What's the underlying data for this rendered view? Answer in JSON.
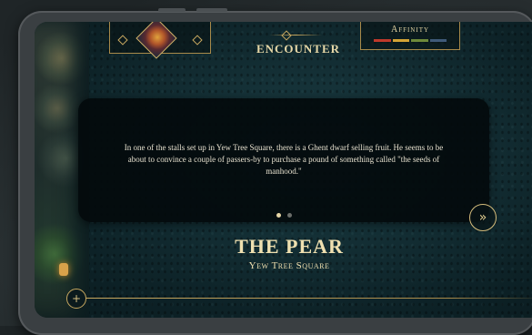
{
  "header": {
    "title": "Encounter",
    "affinity_label": "Affinity",
    "affinity_colors": [
      "#c0392b",
      "#d4a435",
      "#6f8a3a",
      "#3f5a7a"
    ]
  },
  "badge": {
    "portrait_icon": "character-portrait-icon"
  },
  "card": {
    "text": "In one of the stalls set up in Yew Tree Square, there is a Ghent dwarf selling fruit. He seems to be about to convince a couple of passers-by to purchase a pound of something called \"the seeds of manhood.\"",
    "pages_total": 2,
    "page_current": 1
  },
  "next_button": {
    "icon": "next-arrow-icon",
    "glyph": "»"
  },
  "location": {
    "name": "The Pear",
    "subtitle": "Yew Tree Square"
  },
  "menu_button": {
    "icon": "compass-icon",
    "glyph": "+"
  },
  "colors": {
    "accent_gold": "#c9a960",
    "text_light": "#e7e1cf",
    "background_teal": "#143036"
  }
}
